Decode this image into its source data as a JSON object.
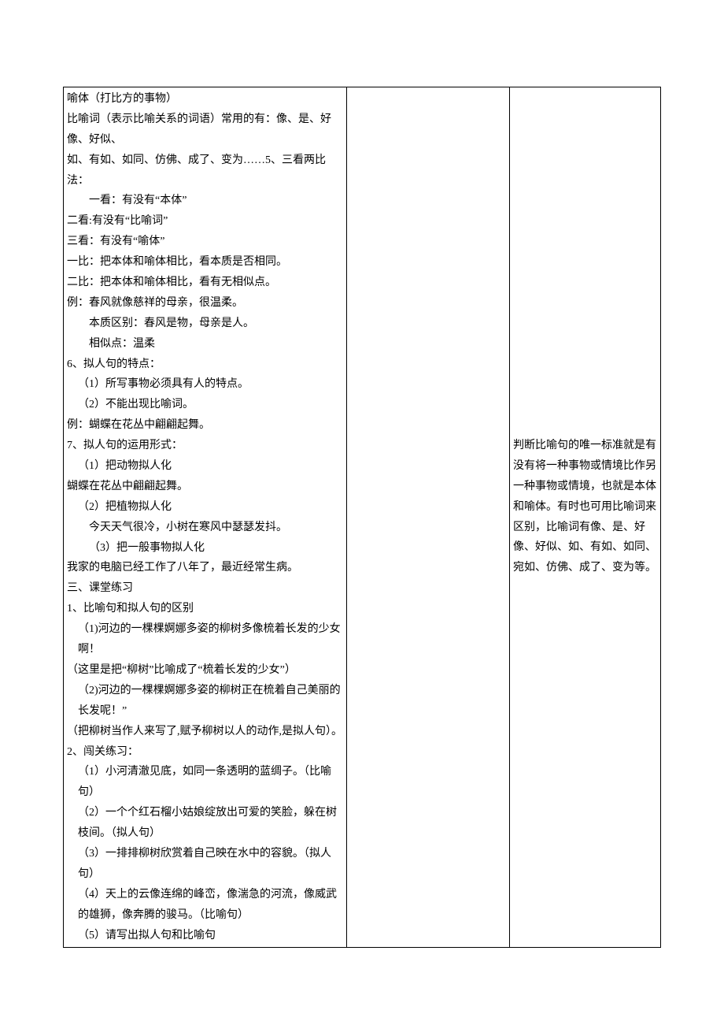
{
  "left": {
    "l01": "喻体（打比方的事物）",
    "l02": "比喻词（表示比喻关系的词语）常用的有：像、是、好像、好似、",
    "l03": "如、有如、如同、仿佛、成了、变为……5、三看两比法：",
    "l04": "一看：有没有“本体”",
    "l05": "二看:有没有“比喻词”",
    "l06": "三看：有没有“喻体”",
    "l07": "一比：把本体和喻体相比，看本质是否相同。",
    "l08": "二比：把本体和喻体相比，看有无相似点。",
    "l09": "例：春风就像慈祥的母亲，很温柔。",
    "l10": "本质区别：春风是物，母亲是人。",
    "l11": "相似点：温柔",
    "l12": "6、拟人句的特点：",
    "l13": "（1）所写事物必须具有人的特点。",
    "l14": "（2）不能出现比喻词。",
    "l15": "例：蝴蝶在花丛中翩翩起舞。",
    "l16": "7、拟人句的运用形式：",
    "l17": "（1）把动物拟人化",
    "l18": "蝴蝶在花丛中翩翩起舞。",
    "l19": "（2）把植物拟人化",
    "l20": "今天天气很冷，小树在寒风中瑟瑟发抖。",
    "l21": "（3）把一般事物拟人化",
    "l22": "我家的电脑已经工作了八年了，最近经常生病。",
    "h3": "三、课堂练习",
    "q1": "1、比喻句和拟人句的区别",
    "q1a": "（1)河边的一棵棵婀娜多姿的柳树多像梳着长发的少女啊！",
    "q1an": "（这里是把“柳树”比喻成了“梳着长发的少女”）",
    "q1b": "（2)河边的一棵棵婀娜多姿的柳树正在梳着自己美丽的长发呢！”",
    "q1bn": "（把柳树当作人来写了,赋予柳树以人的动作,是拟人句）。",
    "q2": "2、闯关练习：",
    "q2a": "（1）小河清澈见底，如同一条透明的蓝绸子。（比喻句）",
    "q2b": "（2）一个个红石榴小姑娘绽放出可爱的笑脸，躲在树枝间。（拟人句）",
    "q2c": "（3）一排排柳树欣赏着自己映在水中的容貌。（拟人句）",
    "q2d": "（4）天上的云像连绵的峰峦，像湍急的河流，像威武的雄狮，像奔腾的骏马。（比喻句）",
    "q2e": "（5）请写出拟人句和比喻句"
  },
  "right": {
    "note": "判断比喻句的唯一标准就是有没有将一种事物或情境比作另一种事物或情境，也就是本体和喻体。有时也可用比喻词来区别，比喻词有像、是、好像、好似、如、有如、如同、宛如、仿佛、成了、变为等。"
  }
}
